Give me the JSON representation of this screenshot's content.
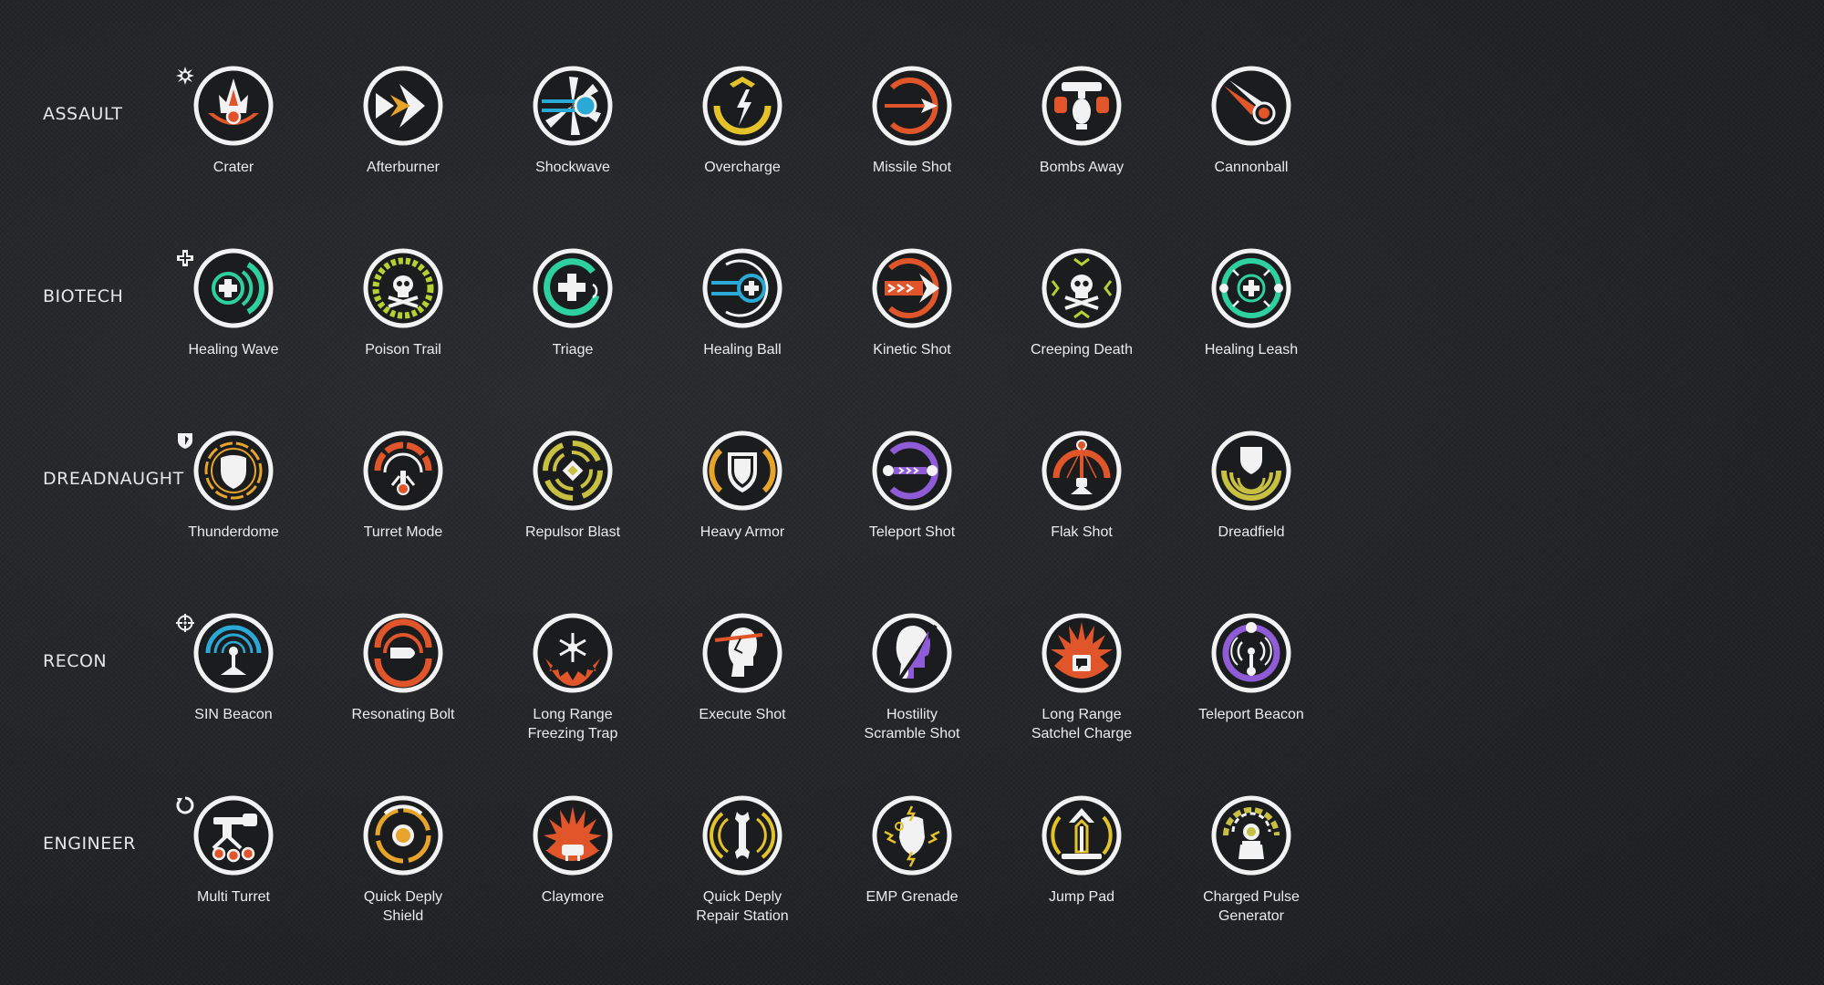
{
  "colors": {
    "background": "#222426",
    "icon_ring": "#f2f2f2",
    "icon_fill": "#1b1c1e",
    "orange": "#e0562a",
    "teal": "#2fd0a0",
    "blue": "#2aa9d6",
    "yellow": "#e4c22a",
    "olive": "#c8c040",
    "lime": "#b5d033",
    "purple": "#8f5bd6",
    "gold": "#e6a52a"
  },
  "rows": [
    {
      "label": "ASSAULT",
      "class_icon": "assault-burst-icon",
      "abilities": [
        {
          "name": "Crater",
          "icon": "crater-icon"
        },
        {
          "name": "Afterburner",
          "icon": "afterburner-icon"
        },
        {
          "name": "Shockwave",
          "icon": "shockwave-icon"
        },
        {
          "name": "Overcharge",
          "icon": "overcharge-icon"
        },
        {
          "name": "Missile Shot",
          "icon": "missile-shot-icon"
        },
        {
          "name": "Bombs Away",
          "icon": "bombs-away-icon"
        },
        {
          "name": "Cannonball",
          "icon": "cannonball-icon"
        }
      ]
    },
    {
      "label": "BIOTECH",
      "class_icon": "biotech-cross-icon",
      "abilities": [
        {
          "name": "Healing Wave",
          "icon": "healing-wave-icon"
        },
        {
          "name": "Poison Trail",
          "icon": "poison-trail-icon"
        },
        {
          "name": "Triage",
          "icon": "triage-icon"
        },
        {
          "name": "Healing Ball",
          "icon": "healing-ball-icon"
        },
        {
          "name": "Kinetic Shot",
          "icon": "kinetic-shot-icon"
        },
        {
          "name": "Creeping Death",
          "icon": "creeping-death-icon"
        },
        {
          "name": "Healing Leash",
          "icon": "healing-leash-icon"
        }
      ]
    },
    {
      "label": "DREADNAUGHT",
      "class_icon": "dreadnaught-shield-icon",
      "abilities": [
        {
          "name": "Thunderdome",
          "icon": "thunderdome-icon"
        },
        {
          "name": "Turret Mode",
          "icon": "turret-mode-icon"
        },
        {
          "name": "Repulsor Blast",
          "icon": "repulsor-blast-icon"
        },
        {
          "name": "Heavy Armor",
          "icon": "heavy-armor-icon"
        },
        {
          "name": "Teleport Shot",
          "icon": "teleport-shot-icon"
        },
        {
          "name": "Flak Shot",
          "icon": "flak-shot-icon"
        },
        {
          "name": "Dreadfield",
          "icon": "dreadfield-icon"
        }
      ]
    },
    {
      "label": "RECON",
      "class_icon": "recon-crosshair-icon",
      "abilities": [
        {
          "name": "SIN Beacon",
          "icon": "sin-beacon-icon"
        },
        {
          "name": "Resonating Bolt",
          "icon": "resonating-bolt-icon"
        },
        {
          "name": "Long Range\nFreezing Trap",
          "icon": "freezing-trap-icon"
        },
        {
          "name": "Execute Shot",
          "icon": "execute-shot-icon"
        },
        {
          "name": "Hostility\nScramble Shot",
          "icon": "hostility-scramble-shot-icon"
        },
        {
          "name": "Long Range\nSatchel Charge",
          "icon": "satchel-charge-icon"
        },
        {
          "name": "Teleport Beacon",
          "icon": "teleport-beacon-icon"
        }
      ]
    },
    {
      "label": "ENGINEER",
      "class_icon": "engineer-wrench-icon",
      "abilities": [
        {
          "name": "Multi Turret",
          "icon": "multi-turret-icon"
        },
        {
          "name": "Quick Deply\nShield",
          "icon": "quick-deploy-shield-icon"
        },
        {
          "name": "Claymore",
          "icon": "claymore-icon"
        },
        {
          "name": "Quick Deply\nRepair Station",
          "icon": "repair-station-icon"
        },
        {
          "name": "EMP Grenade",
          "icon": "emp-grenade-icon"
        },
        {
          "name": "Jump Pad",
          "icon": "jump-pad-icon"
        },
        {
          "name": "Charged Pulse\nGenerator",
          "icon": "charged-pulse-generator-icon"
        }
      ]
    }
  ]
}
